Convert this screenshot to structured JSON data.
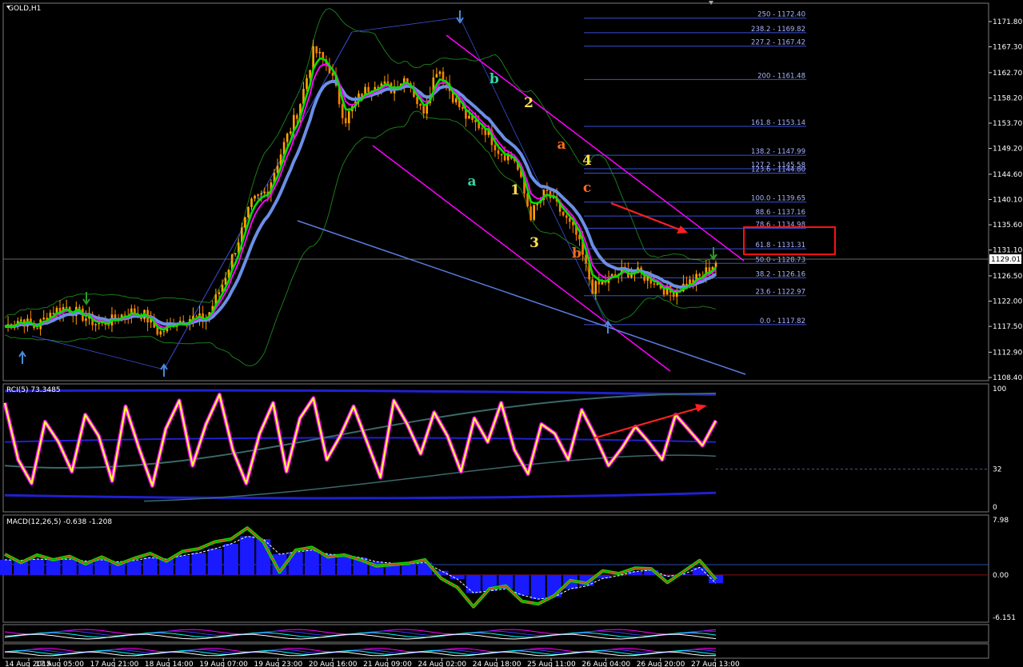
{
  "window": {
    "symbol_title": "GOLD,H1",
    "current_price": "1129.01"
  },
  "colors": {
    "candle_up": "#ffa500",
    "candle_down": "#ff7f00",
    "ema_fast": "#00e000",
    "ema_mid": "#ff00ff",
    "ema_slow": "#6b8fe6",
    "bollinger": "#1a7a1a",
    "fib": "#3a4fd8",
    "channel": "#ff00ff",
    "trendline": "#5a7de0",
    "rci": "#ffff33",
    "rci_glow": "#ff00ff",
    "macd_hist": "#1a1aff",
    "macd_fast": "#00e000",
    "macd_slow": "#ff2020",
    "arrow": "#ff2020"
  },
  "chart_data": [
    {
      "type": "line",
      "panel": "price",
      "title": "GOLD,H1",
      "ylim": [
        1108.4,
        1174.5
      ],
      "y_ticks": [
        "1171.80",
        "1167.30",
        "1162.70",
        "1158.20",
        "1153.70",
        "1149.20",
        "1144.60",
        "1140.10",
        "1135.60",
        "1131.10",
        "1126.50",
        "1122.00",
        "1117.50",
        "1112.90",
        "1108.40"
      ],
      "x_tick_labels": [
        "14 Aug 2015",
        "17 Aug 05:00",
        "17 Aug 21:00",
        "18 Aug 14:00",
        "19 Aug 07:00",
        "19 Aug 23:00",
        "20 Aug 16:00",
        "21 Aug 09:00",
        "24 Aug 02:00",
        "24 Aug 18:00",
        "25 Aug 11:00",
        "26 Aug 04:00",
        "26 Aug 20:00",
        "27 Aug 13:00"
      ],
      "series": [
        {
          "values": [
            1117.5,
            1118.8,
            1117.2,
            1120.1,
            1121.0,
            1119.4,
            1117.9,
            1118.6,
            1120.2,
            1119.6,
            1116.2,
            1118.4,
            1119.0,
            1118.7,
            1124.5,
            1132.0,
            1139.6,
            1141.8,
            1149.5,
            1156.2,
            1166.8,
            1163.5,
            1154.2,
            1158.6,
            1161.2,
            1159.8,
            1162.1,
            1155.4,
            1163.9,
            1158.4,
            1154.1,
            1152.9,
            1148.6,
            1147.2,
            1137.2,
            1141.5,
            1137.8,
            1133.6,
            1124.2,
            1125.7,
            1127.4,
            1126.9,
            1125.6,
            1123.4,
            1124.9,
            1126.3,
            1129.0
          ]
        }
      ],
      "fib_levels": [
        "250 - 1172.40",
        "238.2 - 1169.82",
        "227.2 - 1167.42",
        "200 - 1161.48",
        "161.8 - 1153.14",
        "138.2 - 1147.99",
        "127.2 - 1145.58",
        "123.6 - 1144.80",
        "100.0 - 1139.65",
        "88.6 - 1137.16",
        "78.6 - 1134.98",
        "61.8 - 1131.31",
        "50.0 - 1128.73",
        "38.2 - 1126.16",
        "23.6 - 1122.97",
        "0.0 - 1117.82"
      ],
      "fib_values": [
        1172.4,
        1169.82,
        1167.42,
        1161.48,
        1153.14,
        1147.99,
        1145.58,
        1144.8,
        1139.65,
        1137.16,
        1134.98,
        1131.31,
        1128.73,
        1126.16,
        1122.97,
        1117.82
      ],
      "wave_labels": [
        {
          "text": "b",
          "color": "#33d6a6"
        },
        {
          "text": "2",
          "color": "#ffe14d"
        },
        {
          "text": "a",
          "color": "#ff6a1a"
        },
        {
          "text": "4",
          "color": "#ffe14d"
        },
        {
          "text": "a",
          "color": "#33d6a6"
        },
        {
          "text": "1",
          "color": "#ffe14d"
        },
        {
          "text": "c",
          "color": "#ff6a1a"
        },
        {
          "text": "3",
          "color": "#ffe14d"
        },
        {
          "text": "b",
          "color": "#ff6a1a"
        }
      ]
    },
    {
      "type": "line",
      "panel": "rci",
      "title": "RCI(5) 73.3485",
      "ylim": [
        0,
        100
      ],
      "y_ticks": [
        "100",
        "32",
        "0"
      ],
      "series": [
        {
          "values": [
            88,
            40,
            20,
            72,
            55,
            30,
            78,
            60,
            22,
            85,
            50,
            18,
            66,
            90,
            35,
            70,
            95,
            48,
            20,
            62,
            88,
            30,
            75,
            92,
            40,
            60,
            85,
            55,
            25,
            90,
            70,
            45,
            80,
            60,
            30,
            75,
            55,
            88,
            48,
            28,
            70,
            62,
            40,
            82,
            60,
            35,
            50,
            68,
            55,
            40,
            78,
            65,
            52,
            73
          ]
        }
      ]
    },
    {
      "type": "line",
      "panel": "macd",
      "title": "MACD(12,26,5) -0.638 -1.208",
      "ylim": [
        -6.151,
        7.98
      ],
      "y_ticks": [
        "7.98",
        "0.00",
        "-6.151"
      ],
      "series": [
        {
          "values": [
            3.0,
            1.8,
            2.9,
            2.2,
            2.7,
            1.6,
            2.6,
            1.5,
            2.4,
            3.1,
            2.0,
            3.4,
            3.8,
            4.8,
            5.2,
            6.8,
            4.8,
            0.4,
            3.6,
            4.0,
            2.6,
            2.9,
            2.2,
            1.3,
            1.5,
            1.7,
            2.2,
            -0.5,
            -1.8,
            -4.6,
            -2.0,
            -1.6,
            -3.8,
            -4.2,
            -3.0,
            -0.8,
            -1.2,
            0.6,
            0.2,
            1.0,
            0.9,
            -1.1,
            0.5,
            2.1,
            -0.638
          ]
        },
        {
          "values": [
            2.2,
            2.1,
            2.3,
            2.2,
            2.3,
            2.0,
            2.2,
            1.9,
            2.1,
            2.5,
            2.3,
            2.8,
            3.2,
            3.8,
            4.5,
            5.6,
            5.2,
            3.0,
            3.3,
            3.6,
            3.0,
            2.9,
            2.5,
            1.9,
            1.7,
            1.6,
            1.8,
            0.6,
            -0.6,
            -2.6,
            -2.3,
            -2.0,
            -2.9,
            -3.5,
            -3.2,
            -2.0,
            -1.6,
            -0.5,
            -0.1,
            0.5,
            0.7,
            -0.2,
            0.1,
            1.1,
            -1.208
          ]
        }
      ]
    }
  ]
}
